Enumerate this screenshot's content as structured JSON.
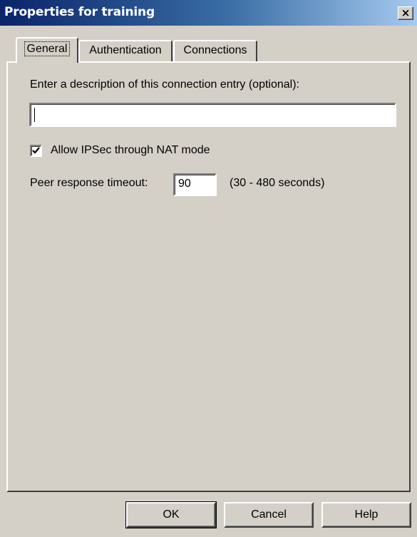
{
  "window": {
    "title": "Properties for training",
    "close_glyph": "×"
  },
  "tabs": [
    {
      "label": "General",
      "active": true
    },
    {
      "label": "Authentication",
      "active": false
    },
    {
      "label": "Connections",
      "active": false
    }
  ],
  "general": {
    "description_label": "Enter a description of this connection entry (optional):",
    "description_value": "",
    "nat_checkbox_label": "Allow IPSec through NAT mode",
    "nat_checked": true,
    "timeout_label": "Peer response timeout:",
    "timeout_value": "90",
    "timeout_range": "(30 - 480 seconds)"
  },
  "buttons": {
    "ok": "OK",
    "cancel": "Cancel",
    "help": "Help"
  },
  "colors": {
    "titlebar_start": "#0a246a",
    "titlebar_end": "#a6caf0",
    "face": "#d4d0c8"
  },
  "icons": {
    "close": "close-icon",
    "check": "checkmark-icon"
  }
}
